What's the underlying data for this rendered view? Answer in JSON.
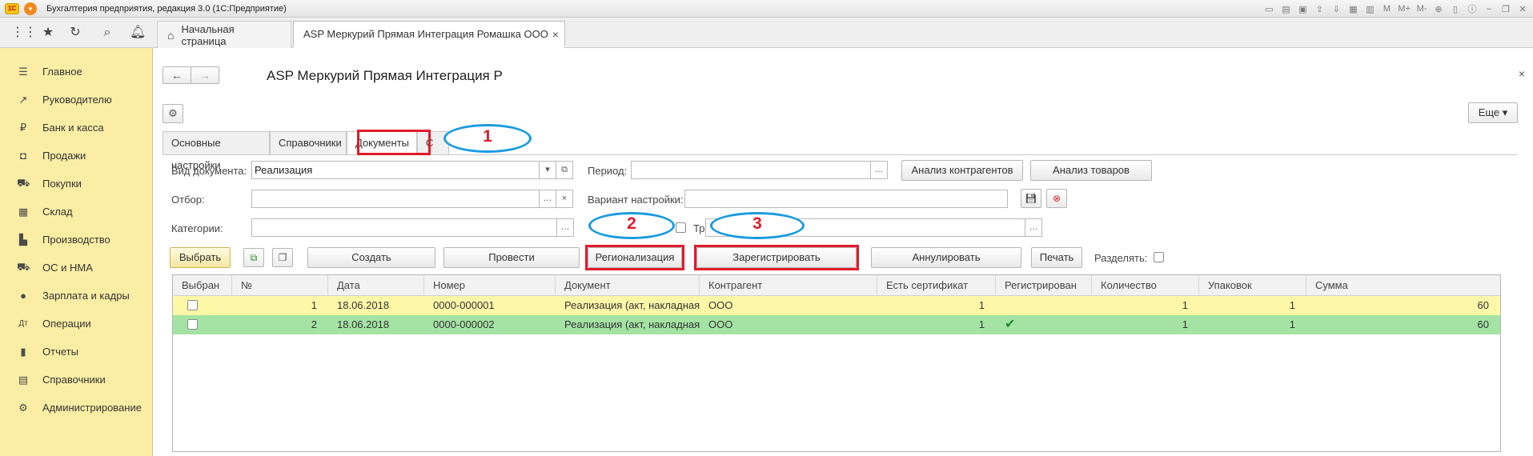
{
  "window": {
    "logo": "1С",
    "title": "Бухгалтерия предприятия, редакция 3.0  (1С:Предприятие)",
    "toolbar_icons": [
      "save-icon",
      "print-icon",
      "preview-icon",
      "upload-icon",
      "download-icon",
      "calendar-icon",
      "calculator-icon",
      "M",
      "M+",
      "M-",
      "zoom-icon",
      "panels-icon",
      "info-icon",
      "minimize-icon",
      "restore-icon",
      "close-icon"
    ],
    "toolbar_labels": {
      "m": "M",
      "mplus": "M+",
      "mminus": "M-"
    }
  },
  "tabs": {
    "home": "Начальная страница",
    "active": "ASP Меркурий Прямая Интеграция Ромашка ООО"
  },
  "sidebar": {
    "items": [
      {
        "label": "Главное",
        "icon": "menu-icon"
      },
      {
        "label": "Руководителю",
        "icon": "chart-icon"
      },
      {
        "label": "Банк и касса",
        "icon": "ruble-icon"
      },
      {
        "label": "Продажи",
        "icon": "bag-icon"
      },
      {
        "label": "Покупки",
        "icon": "cart-icon"
      },
      {
        "label": "Склад",
        "icon": "warehouse-icon"
      },
      {
        "label": "Производство",
        "icon": "factory-icon"
      },
      {
        "label": "ОС и НМА",
        "icon": "truck-icon"
      },
      {
        "label": "Зарплата и кадры",
        "icon": "person-icon"
      },
      {
        "label": "Операции",
        "icon": "operations-icon"
      },
      {
        "label": "Отчеты",
        "icon": "bar-chart-icon"
      },
      {
        "label": "Справочники",
        "icon": "book-icon"
      },
      {
        "label": "Администрирование",
        "icon": "gear-icon"
      }
    ]
  },
  "form": {
    "title": "ASP Меркурий Прямая Интеграция Р",
    "more_button": "Еще",
    "tabs": [
      "Основные настройки",
      "Справочники",
      "Документы",
      "С"
    ],
    "fields": {
      "doc_type_label": "Вид документа:",
      "doc_type_value": "Реализация",
      "period_label": "Период:",
      "period_value": "",
      "filter_label": "Отбор:",
      "filter_value": "",
      "variant_label": "Вариант настройки:",
      "variant_value": "",
      "categories_label": "Категории:",
      "categories_value": "",
      "tr_label": "Тр",
      "tr_value": "",
      "split_label": "Разделять:"
    },
    "buttons": {
      "analysis_contragents": "Анализ контрагентов",
      "analysis_goods": "Анализ товаров",
      "select": "Выбрать",
      "create": "Создать",
      "post": "Провести",
      "regionalize": "Регионализация",
      "register": "Зарегистрировать",
      "cancel": "Аннулировать",
      "print": "Печать"
    },
    "annotations": [
      "1",
      "2",
      "3"
    ]
  },
  "table": {
    "columns": [
      "Выбран",
      "№",
      "Дата",
      "Номер",
      "Документ",
      "Контрагент",
      "Есть сертификат",
      "Регистрирован",
      "Количество",
      "Упаковок",
      "Сумма"
    ],
    "rows": [
      {
        "selected": false,
        "n": "1",
        "date": "18.06.2018",
        "number": "0000-000001",
        "document": "Реализация (акт, накладная) ...",
        "contragent": "ООО",
        "cert": "1",
        "registered": false,
        "qty": "1",
        "packs": "1",
        "sum": "60"
      },
      {
        "selected": false,
        "n": "2",
        "date": "18.06.2018",
        "number": "0000-000002",
        "document": "Реализация (акт, накладная) ...",
        "contragent": "ООО",
        "cert": "1",
        "registered": true,
        "qty": "1",
        "packs": "1",
        "sum": "60"
      }
    ]
  },
  "colors": {
    "sidebar_bg": "#fbeda4",
    "row_selected": "#fdf8a8",
    "row_registered": "#a4e3a3",
    "annotation_red": "#e21b2b",
    "annotation_blue": "#1a9be0"
  }
}
